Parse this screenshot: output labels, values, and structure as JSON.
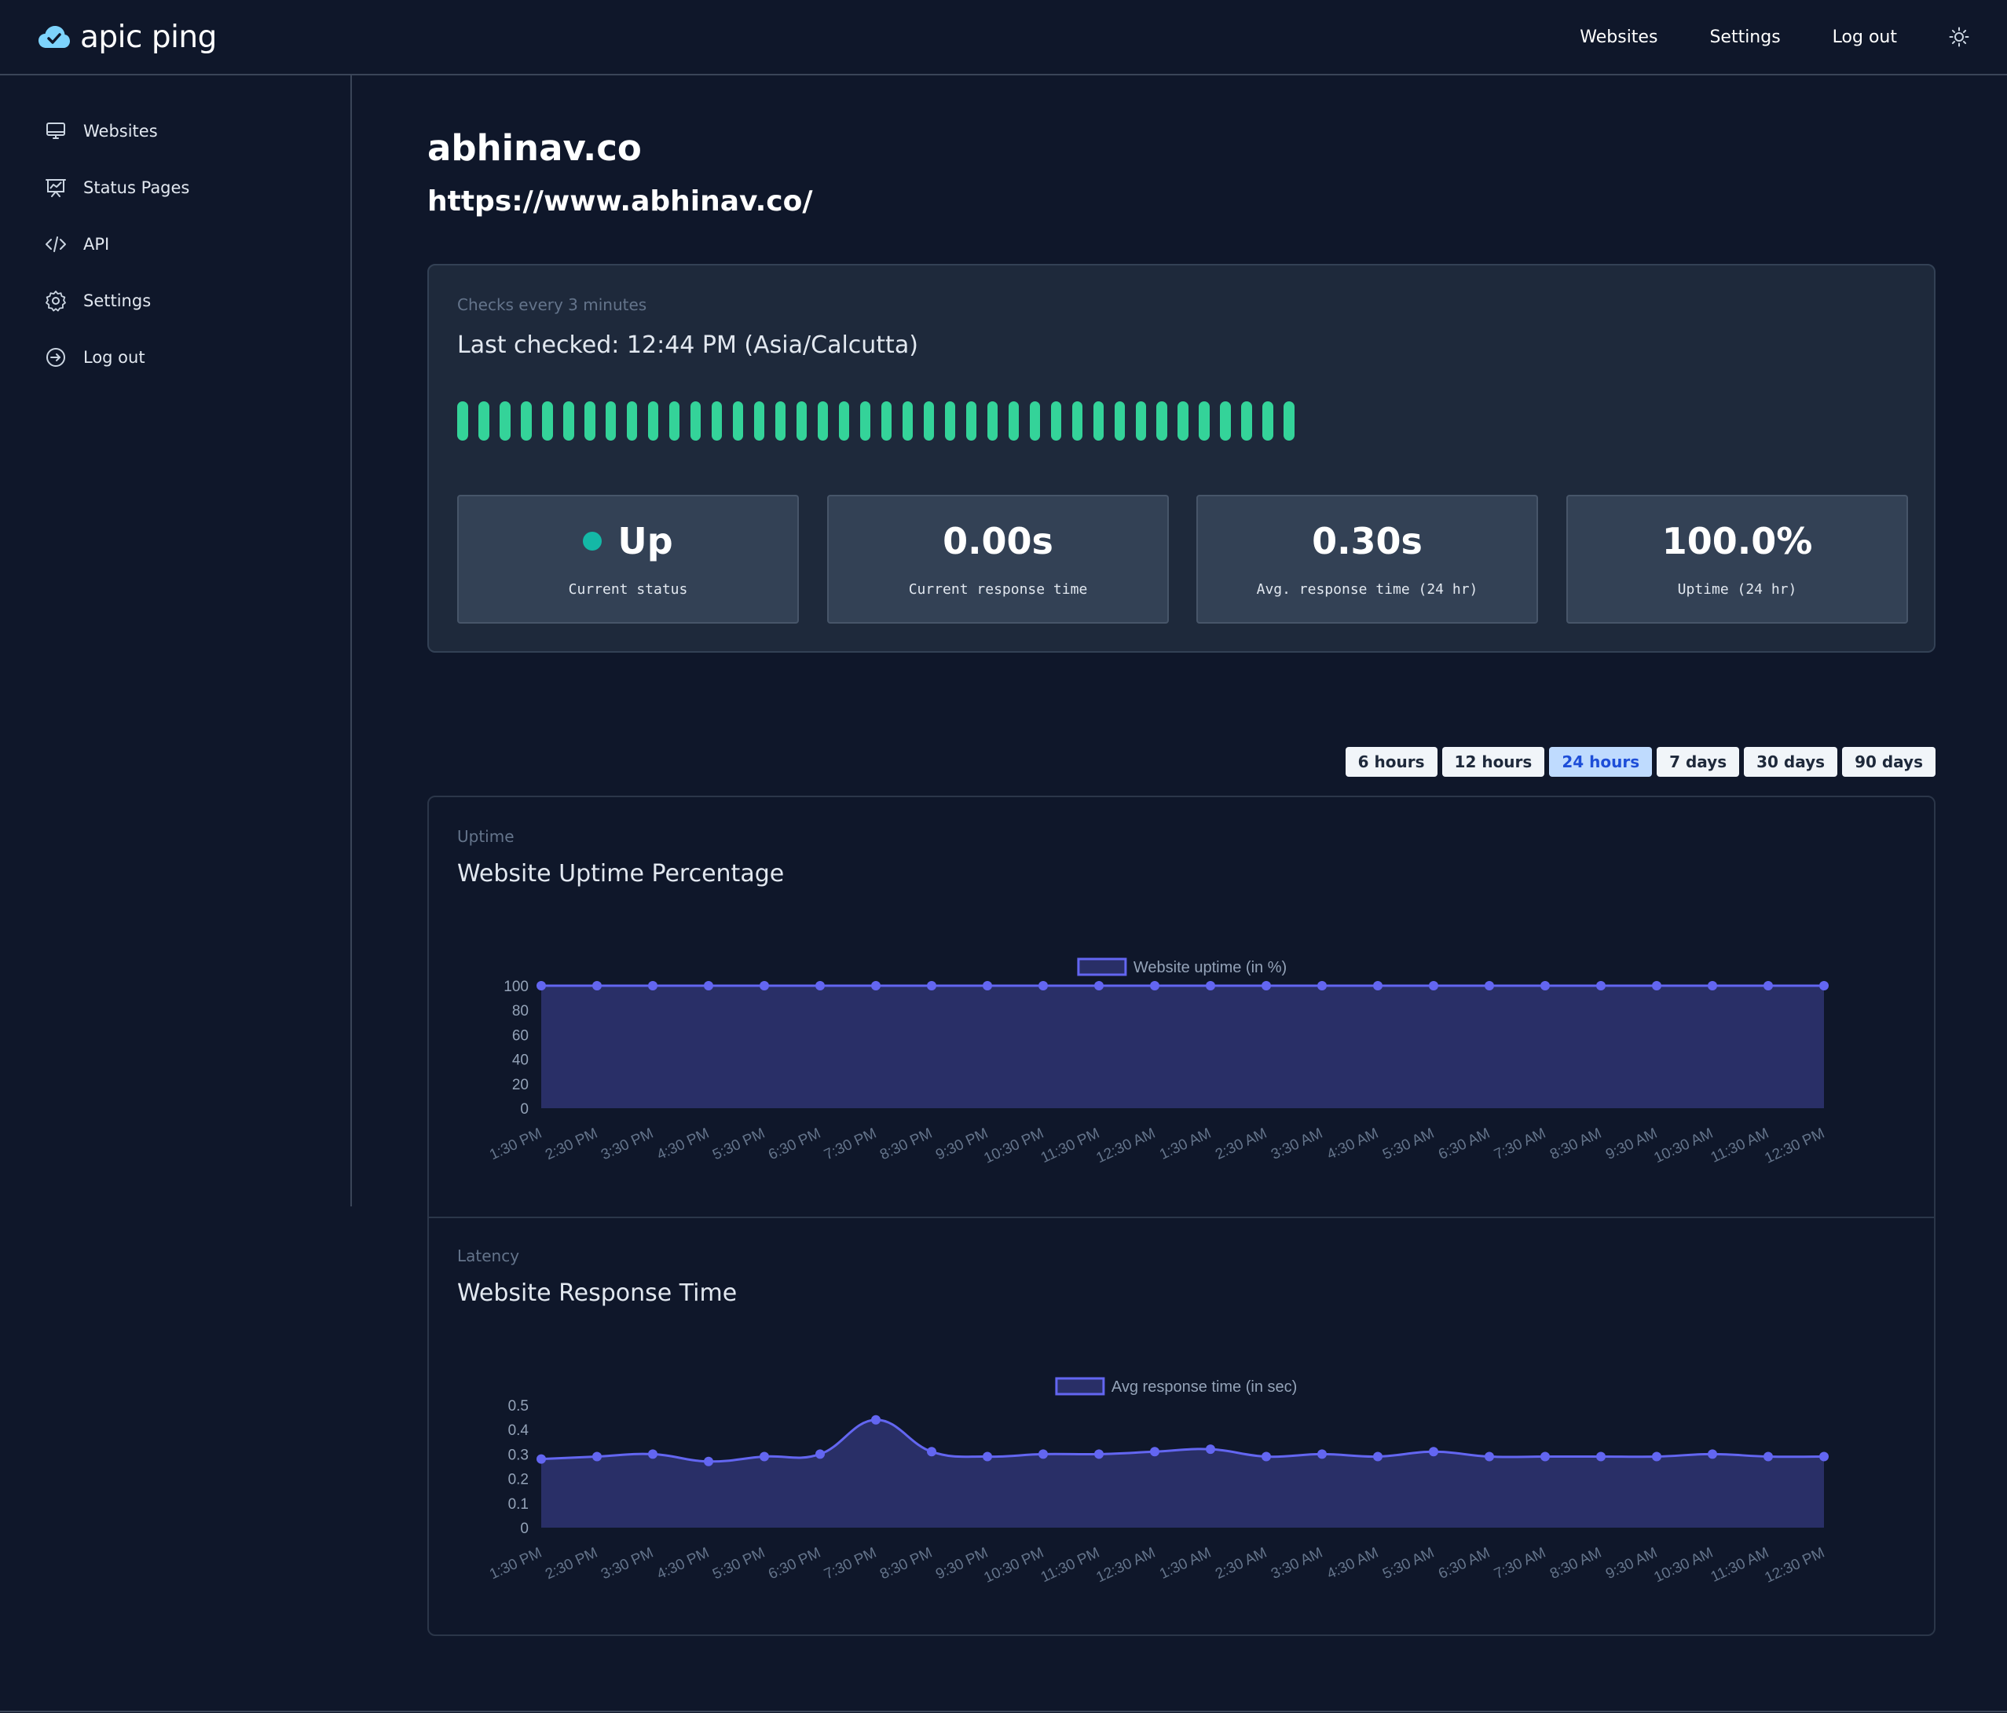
{
  "brand": {
    "name": "apic ping"
  },
  "topnav": {
    "websites": "Websites",
    "settings": "Settings",
    "logout": "Log out"
  },
  "sidebar": {
    "items": [
      {
        "label": "Websites",
        "icon": "monitor-icon"
      },
      {
        "label": "Status Pages",
        "icon": "presentation-chart-icon"
      },
      {
        "label": "API",
        "icon": "code-icon"
      },
      {
        "label": "Settings",
        "icon": "gear-icon"
      },
      {
        "label": "Log out",
        "icon": "logout-icon"
      }
    ]
  },
  "site": {
    "name": "abhinav.co",
    "url": "https://www.abhinav.co/"
  },
  "status_card": {
    "checks_every": "Checks every 3 minutes",
    "last_checked": "Last checked: 12:44 PM (Asia/Calcutta)",
    "heartbeat_count": 40,
    "heartbeat_color": "#34d399",
    "stats": [
      {
        "value": "Up",
        "label": "Current status"
      },
      {
        "value": "0.00s",
        "label": "Current response time"
      },
      {
        "value": "0.30s",
        "label": "Avg. response time (24 hr)"
      },
      {
        "value": "100.0%",
        "label": "Uptime (24 hr)"
      }
    ]
  },
  "ranges": {
    "options": [
      "6 hours",
      "12 hours",
      "24 hours",
      "7 days",
      "30 days",
      "90 days"
    ],
    "selected": "24 hours"
  },
  "uptime_section": {
    "eyebrow": "Uptime",
    "title": "Website Uptime Percentage"
  },
  "latency_section": {
    "eyebrow": "Latency",
    "title": "Website Response Time"
  },
  "chart_data": [
    {
      "type": "area",
      "legend": "Website uptime (in %)",
      "categories": [
        "1:30 PM",
        "2:30 PM",
        "3:30 PM",
        "4:30 PM",
        "5:30 PM",
        "6:30 PM",
        "7:30 PM",
        "8:30 PM",
        "9:30 PM",
        "10:30 PM",
        "11:30 PM",
        "12:30 AM",
        "1:30 AM",
        "2:30 AM",
        "3:30 AM",
        "4:30 AM",
        "5:30 AM",
        "6:30 AM",
        "7:30 AM",
        "8:30 AM",
        "9:30 AM",
        "10:30 AM",
        "11:30 AM",
        "12:30 PM"
      ],
      "values": [
        100,
        100,
        100,
        100,
        100,
        100,
        100,
        100,
        100,
        100,
        100,
        100,
        100,
        100,
        100,
        100,
        100,
        100,
        100,
        100,
        100,
        100,
        100,
        100
      ],
      "yticks": [
        0,
        20,
        40,
        60,
        80,
        100
      ],
      "ylim": [
        0,
        100
      ],
      "line_color": "#6366f1",
      "fill_color": "#292f67"
    },
    {
      "type": "area",
      "legend": "Avg response time (in sec)",
      "categories": [
        "1:30 PM",
        "2:30 PM",
        "3:30 PM",
        "4:30 PM",
        "5:30 PM",
        "6:30 PM",
        "7:30 PM",
        "8:30 PM",
        "9:30 PM",
        "10:30 PM",
        "11:30 PM",
        "12:30 AM",
        "1:30 AM",
        "2:30 AM",
        "3:30 AM",
        "4:30 AM",
        "5:30 AM",
        "6:30 AM",
        "7:30 AM",
        "8:30 AM",
        "9:30 AM",
        "10:30 AM",
        "11:30 AM",
        "12:30 PM"
      ],
      "values": [
        0.28,
        0.29,
        0.3,
        0.27,
        0.29,
        0.3,
        0.44,
        0.31,
        0.29,
        0.3,
        0.3,
        0.31,
        0.32,
        0.29,
        0.3,
        0.29,
        0.31,
        0.29,
        0.29,
        0.29,
        0.29,
        0.3,
        0.29,
        0.29
      ],
      "yticks": [
        0,
        0.1,
        0.2,
        0.3,
        0.4,
        0.5
      ],
      "ylim": [
        0,
        0.5
      ],
      "line_color": "#6366f1",
      "fill_color": "#292f67"
    }
  ]
}
